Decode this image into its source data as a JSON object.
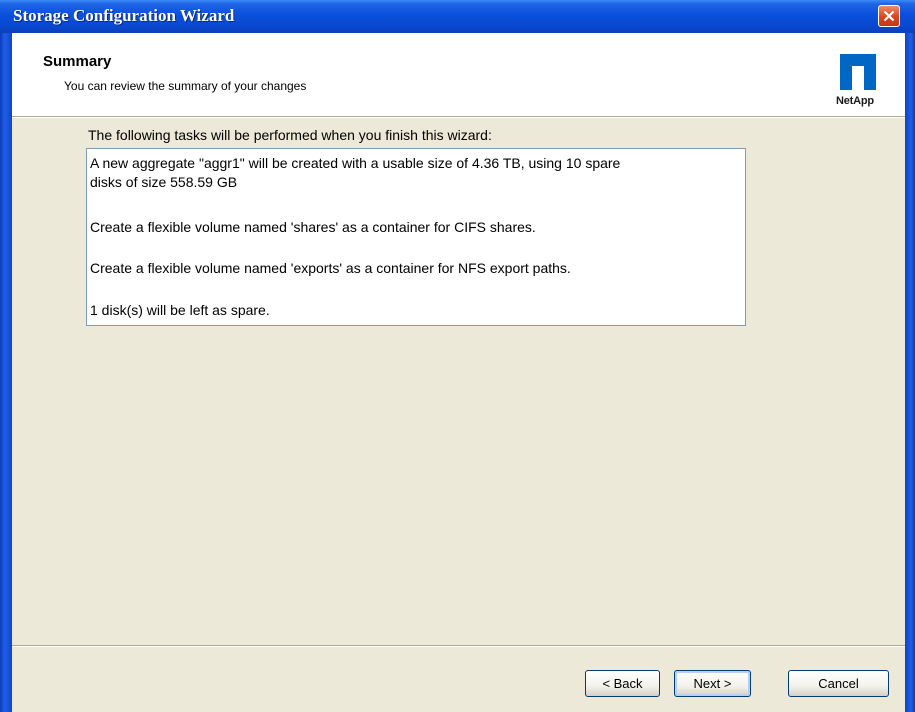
{
  "window": {
    "title": "Storage Configuration Wizard",
    "close_icon": "close-x-icon"
  },
  "header": {
    "title": "Summary",
    "subtitle": "You can review the summary of your changes",
    "logo_text": "NetApp"
  },
  "main": {
    "intro": "The following tasks will be performed when you finish this wizard:",
    "summary_lines": [
      "A new aggregate \"aggr1\" will be created with a usable size of 4.36 TB, using 10 spare",
      "disks of size 558.59 GB",
      "Create a flexible volume named 'shares' as a container for CIFS shares.",
      "Create a flexible volume named 'exports' as a container for NFS export paths.",
      "1 disk(s) will be left as spare."
    ]
  },
  "footer": {
    "back_label": "< Back",
    "next_label": "Next >",
    "cancel_label": "Cancel"
  },
  "colors": {
    "titlebar": "#0a50dc",
    "dialog_bg": "#ece9d8",
    "logo": "#0067c5"
  }
}
